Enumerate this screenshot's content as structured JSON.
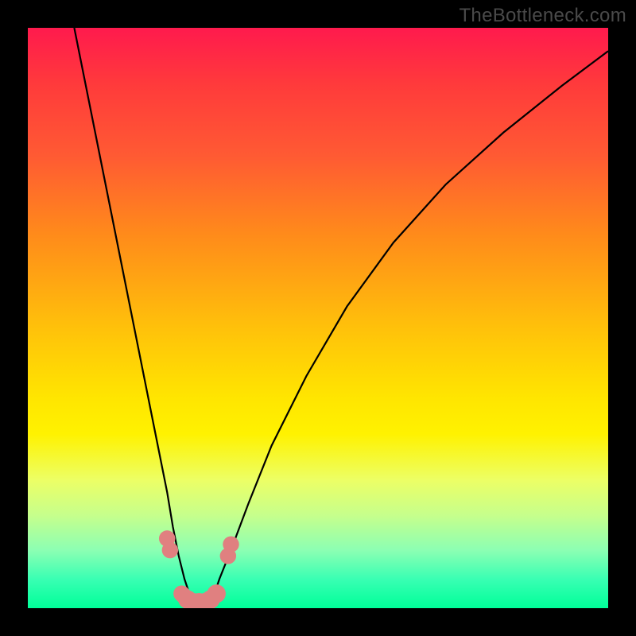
{
  "watermark": "TheBottleneck.com",
  "chart_data": {
    "type": "line",
    "title": "",
    "xlabel": "",
    "ylabel": "",
    "xlim": [
      0,
      100
    ],
    "ylim": [
      0,
      100
    ],
    "background_gradient": {
      "orientation": "vertical",
      "stops": [
        {
          "pos": 0,
          "color": "#ff1a4d"
        },
        {
          "pos": 22,
          "color": "#ff5a33"
        },
        {
          "pos": 52,
          "color": "#ffc20a"
        },
        {
          "pos": 70,
          "color": "#fff200"
        },
        {
          "pos": 90,
          "color": "#8cffb3"
        },
        {
          "pos": 100,
          "color": "#00ff99"
        }
      ]
    },
    "series": [
      {
        "name": "bottleneck-curve",
        "x": [
          8,
          10,
          12,
          14,
          16,
          18,
          20,
          22,
          24,
          25,
          26,
          27,
          28,
          29,
          30,
          31,
          32,
          33,
          35,
          38,
          42,
          48,
          55,
          63,
          72,
          82,
          92,
          100
        ],
        "y": [
          100,
          90,
          80,
          70,
          60,
          50,
          40,
          30,
          20,
          14,
          9,
          5,
          2,
          0,
          0,
          0,
          2,
          5,
          10,
          18,
          28,
          40,
          52,
          63,
          73,
          82,
          90,
          96
        ]
      }
    ],
    "markers": [
      {
        "name": "point",
        "x": 24.0,
        "y": 12.0,
        "color": "#e08080",
        "r": 1.4
      },
      {
        "name": "point",
        "x": 24.5,
        "y": 10.0,
        "color": "#e08080",
        "r": 1.4
      },
      {
        "name": "point",
        "x": 26.5,
        "y": 2.5,
        "color": "#e08080",
        "r": 1.4
      },
      {
        "name": "point",
        "x": 27.5,
        "y": 1.5,
        "color": "#e08080",
        "r": 1.6
      },
      {
        "name": "point",
        "x": 28.5,
        "y": 1.0,
        "color": "#e08080",
        "r": 1.6
      },
      {
        "name": "point",
        "x": 29.5,
        "y": 1.0,
        "color": "#e08080",
        "r": 1.6
      },
      {
        "name": "point",
        "x": 30.5,
        "y": 1.0,
        "color": "#e08080",
        "r": 1.6
      },
      {
        "name": "point",
        "x": 31.5,
        "y": 1.5,
        "color": "#e08080",
        "r": 1.6
      },
      {
        "name": "point",
        "x": 32.5,
        "y": 2.5,
        "color": "#e08080",
        "r": 1.6
      },
      {
        "name": "point",
        "x": 34.5,
        "y": 9.0,
        "color": "#e08080",
        "r": 1.4
      },
      {
        "name": "point",
        "x": 35.0,
        "y": 11.0,
        "color": "#e08080",
        "r": 1.4
      }
    ],
    "segment": {
      "name": "bottom-segment",
      "color": "#e08080",
      "width": 2.8,
      "x": [
        26.5,
        27.5,
        28.5,
        29.5,
        30.5,
        31.5,
        32.5
      ],
      "y": [
        2.5,
        1.5,
        1.0,
        1.0,
        1.0,
        1.5,
        2.5
      ]
    }
  }
}
